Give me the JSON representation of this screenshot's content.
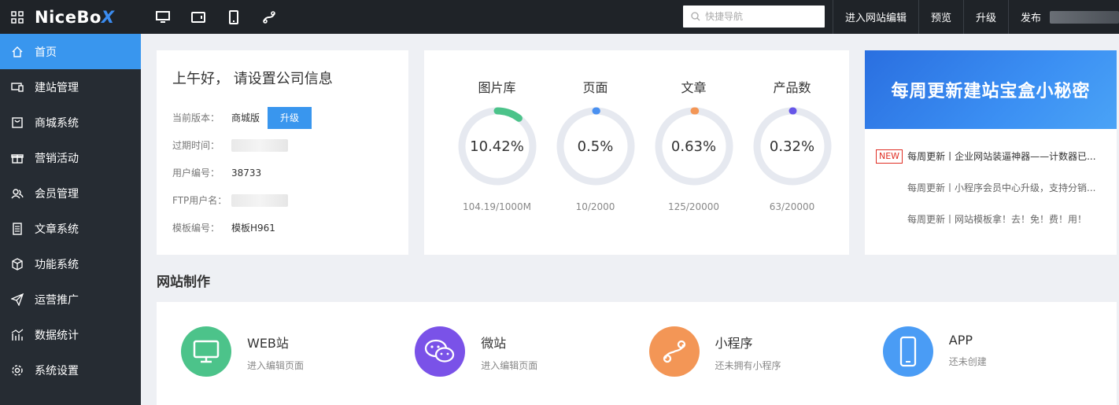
{
  "topbar": {
    "logo_main": "NiceBo",
    "logo_x": "X",
    "search_placeholder": "快捷导航",
    "nav": [
      "进入网站编辑",
      "预览",
      "升级",
      "发布"
    ],
    "colors": {
      "bg": "#1f2328",
      "accent": "#3b8cf0"
    }
  },
  "sidebar": {
    "items": [
      {
        "label": "首页",
        "icon": "home-icon"
      },
      {
        "label": "建站管理",
        "icon": "monitor-icon"
      },
      {
        "label": "商城系统",
        "icon": "shop-icon"
      },
      {
        "label": "营销活动",
        "icon": "gift-icon"
      },
      {
        "label": "会员管理",
        "icon": "users-icon"
      },
      {
        "label": "文章系统",
        "icon": "document-icon"
      },
      {
        "label": "功能系统",
        "icon": "cube-icon"
      },
      {
        "label": "运营推广",
        "icon": "send-icon"
      },
      {
        "label": "数据统计",
        "icon": "chart-icon"
      },
      {
        "label": "系统设置",
        "icon": "gear-icon"
      }
    ]
  },
  "info": {
    "greeting": "上午好， 请设置公司信息",
    "version_label": "当前版本：",
    "version_value": "商城版",
    "upgrade_label": "升级",
    "expire_label": "过期时间：",
    "user_no_label": "用户编号：",
    "user_no_value": "38733",
    "ftp_label": "FTP用户名：",
    "template_label": "模板编号：",
    "template_value": "模板H961"
  },
  "stats": [
    {
      "title": "图片库",
      "percent": "10.42%",
      "value": 10.42,
      "detail": "104.19/1000M",
      "color": "#4cc38a"
    },
    {
      "title": "页面",
      "percent": "0.5%",
      "value": 0.5,
      "detail": "10/2000",
      "color": "#4a90f0"
    },
    {
      "title": "文章",
      "percent": "0.63%",
      "value": 0.63,
      "detail": "125/20000",
      "color": "#f39656"
    },
    {
      "title": "产品数",
      "percent": "0.32%",
      "value": 0.32,
      "detail": "63/20000",
      "color": "#6656e8"
    }
  ],
  "news": {
    "banner": "每周更新建站宝盒小秘密",
    "badge": "NEW",
    "items": [
      "每周更新丨企业网站装逼神器——计数器已...",
      "每周更新丨小程序会员中心升级，支持分销...",
      "每周更新丨网站模板拿！去！免！费！用！"
    ]
  },
  "section_title": "网站制作",
  "make": [
    {
      "name": "WEB站",
      "desc": "进入编辑页面",
      "color": "#4cc38a",
      "icon": "monitor-icon"
    },
    {
      "name": "微站",
      "desc": "进入编辑页面",
      "color": "#7a52e8",
      "icon": "wechat-icon"
    },
    {
      "name": "小程序",
      "desc": "还未拥有小程序",
      "color": "#f39656",
      "icon": "miniprogram-icon"
    },
    {
      "name": "APP",
      "desc": "还未创建",
      "color": "#4a9cf5",
      "icon": "phone-icon"
    }
  ]
}
